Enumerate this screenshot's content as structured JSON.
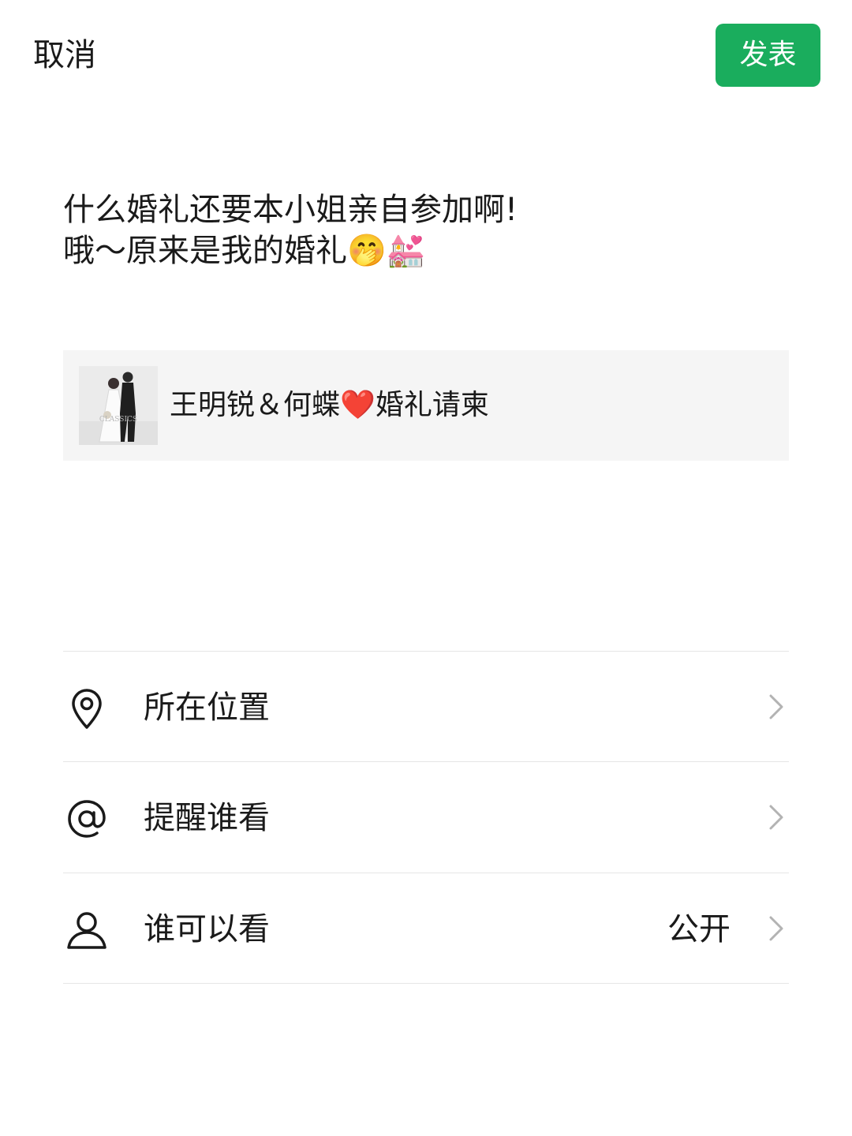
{
  "header": {
    "cancel_label": "取消",
    "publish_label": "发表",
    "accent_color": "#1aad5d"
  },
  "post": {
    "line1": "什么婚礼还要本小姐亲自参加啊!",
    "line2": "哦～原来是我的婚礼🤭💒"
  },
  "link_card": {
    "title": "王明锐＆何蝶❤️婚礼请柬",
    "thumbnail": "wedding-photo",
    "thumbnail_watermark": "CLASSICS"
  },
  "options": [
    {
      "icon": "location-pin-icon",
      "label": "所在位置",
      "value": ""
    },
    {
      "icon": "at-sign-icon",
      "label": "提醒谁看",
      "value": ""
    },
    {
      "icon": "person-icon",
      "label": "谁可以看",
      "value": "公开"
    }
  ]
}
